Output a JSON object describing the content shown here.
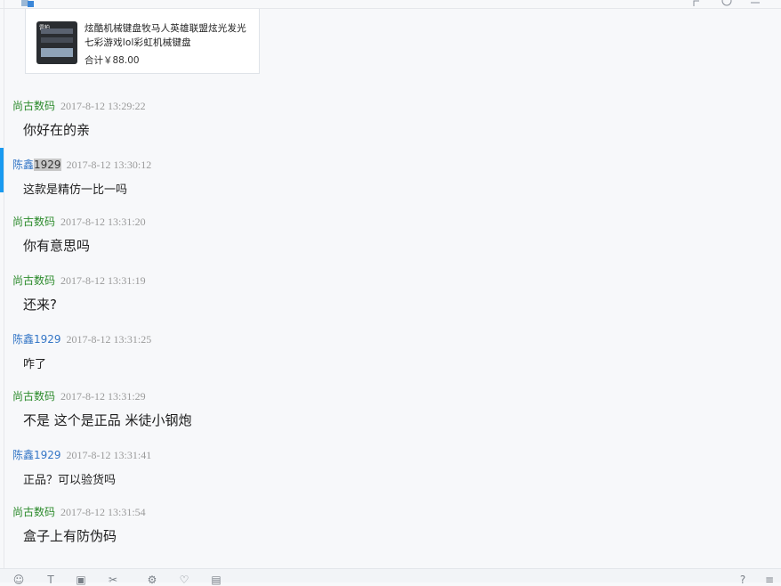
{
  "product": {
    "title": "炫酷机械键盘牧马人英雄联盟炫光发光七彩游戏lol彩虹机械键盘",
    "total": "合计￥88.00",
    "thumb_label": "雷柏"
  },
  "messages": [
    {
      "sender": "尚古数码",
      "role": "shop",
      "time": "2017-8-12 13:29:22",
      "text": "你好在的亲"
    },
    {
      "sender_prefix": "陈鑫",
      "sender_hl": "1929",
      "role": "buyer",
      "time": "2017-8-12 13:30:12",
      "text": "这款是精仿一比一吗",
      "active": true
    },
    {
      "sender": "尚古数码",
      "role": "shop",
      "time": "2017-8-12 13:31:20",
      "text": "你有意思吗"
    },
    {
      "sender": "尚古数码",
      "role": "shop",
      "time": "2017-8-12 13:31:19",
      "text": "还来?"
    },
    {
      "sender": "陈鑫1929",
      "role": "buyer",
      "time": "2017-8-12 13:31:25",
      "text": "咋了"
    },
    {
      "sender": "尚古数码",
      "role": "shop",
      "time": "2017-8-12 13:31:29",
      "text": "不是 这个是正品 米徒小钢炮"
    },
    {
      "sender": "陈鑫1929",
      "role": "buyer",
      "time": "2017-8-12 13:31:41",
      "text": "正品？可以验货吗"
    },
    {
      "sender": "尚古数码",
      "role": "shop",
      "time": "2017-8-12 13:31:54",
      "text": "盒子上有防伪码"
    }
  ],
  "toolbar": {
    "icons": [
      "emoji-icon",
      "font-icon",
      "image-icon",
      "scissors-icon",
      "shake-icon",
      "heart-icon",
      "history-icon",
      "help-icon",
      "menu-icon"
    ],
    "glyphs": [
      "☺",
      "T",
      "▣",
      "✂",
      "⚙",
      "♡",
      "▤",
      "?",
      "≡"
    ]
  },
  "colors": {
    "shop": "#2b8a2b",
    "buyer": "#3476c6",
    "active_bar": "#1a9af0"
  }
}
